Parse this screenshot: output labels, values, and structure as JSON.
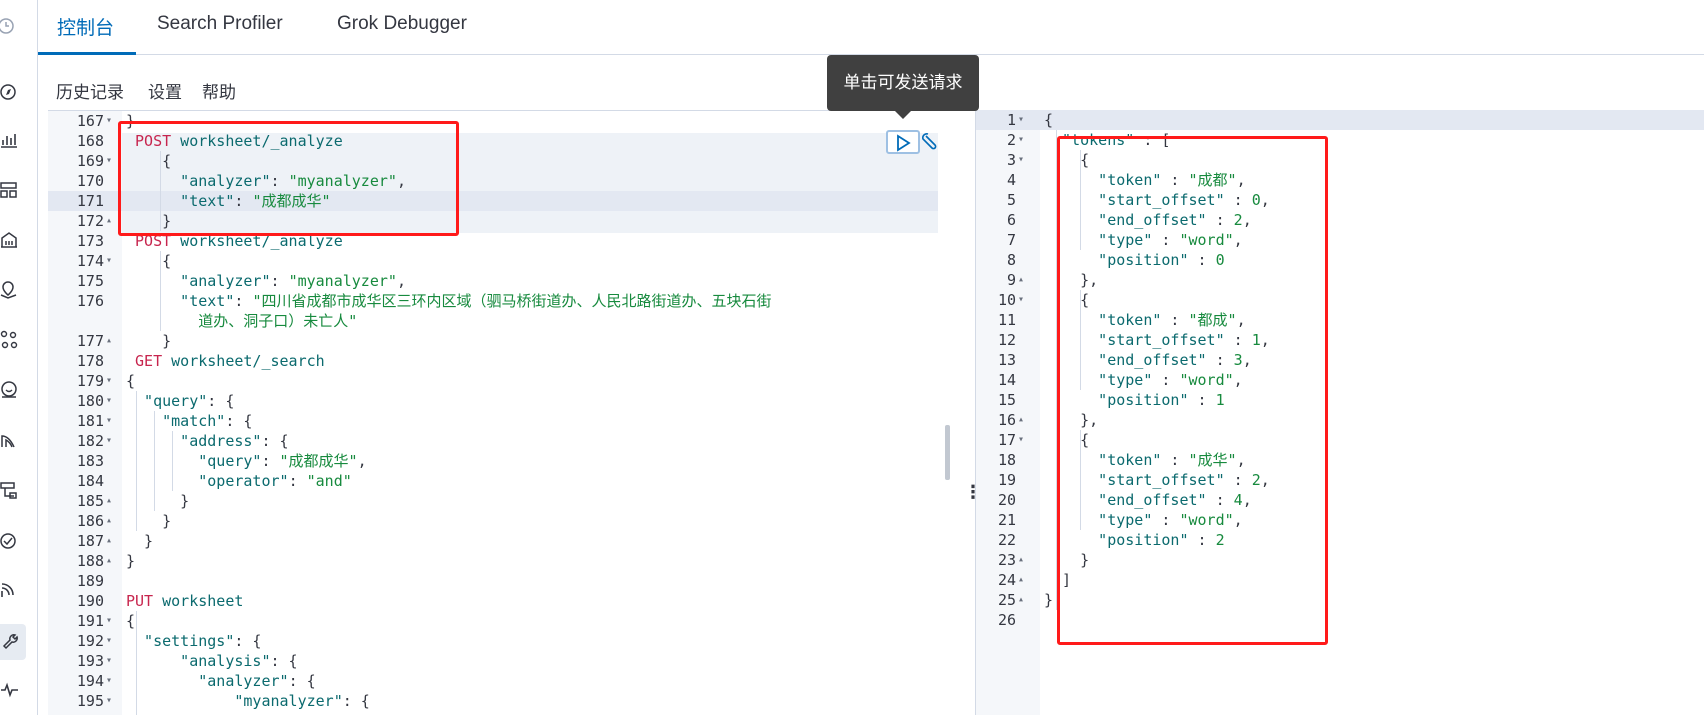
{
  "tabs": [
    {
      "label": "控制台",
      "active": true
    },
    {
      "label": "Search Profiler",
      "active": false
    },
    {
      "label": "Grok Debugger",
      "active": false
    }
  ],
  "subnav": {
    "history": "历史记录",
    "settings": "设置",
    "help": "帮助"
  },
  "tooltip": "单击可发送请求",
  "sidebar_icons": [
    "clock-icon",
    "compass-icon",
    "chart-icon",
    "dashboard-icon",
    "building-icon",
    "map-icon",
    "graph-icon",
    "face-icon",
    "apm-icon",
    "infra-icon",
    "uptime-icon",
    "signal-icon",
    "wrench-icon",
    "heartbeat-icon"
  ],
  "colors": {
    "accent": "#006bb8",
    "keyword": "#c7254e",
    "url": "#0b6a6e",
    "string": "#178a3e",
    "annotation": "#ff1a1a"
  },
  "request_lines": [
    {
      "n": "167",
      "fold": "▾",
      "segs": [
        {
          "t": "}",
          "c": "p"
        }
      ]
    },
    {
      "n": "168",
      "fold": "",
      "segs": [
        {
          "t": " POST",
          "c": "k"
        },
        {
          "t": " worksheet/_analyze",
          "c": "u"
        }
      ]
    },
    {
      "n": "169",
      "fold": "▾",
      "segs": [
        {
          "t": "    {",
          "c": "p"
        }
      ]
    },
    {
      "n": "170",
      "fold": "",
      "segs": [
        {
          "t": "      \"analyzer\"",
          "c": "u"
        },
        {
          "t": ": ",
          "c": "p"
        },
        {
          "t": "\"myanalyzer\"",
          "c": "s"
        },
        {
          "t": ",",
          "c": "p"
        }
      ]
    },
    {
      "n": "171",
      "fold": "",
      "segs": [
        {
          "t": "      \"text\"",
          "c": "u"
        },
        {
          "t": ": ",
          "c": "p"
        },
        {
          "t": "\"成都成华\"",
          "c": "s"
        }
      ]
    },
    {
      "n": "172",
      "fold": "▴",
      "segs": [
        {
          "t": "    }",
          "c": "p"
        }
      ]
    },
    {
      "n": "173",
      "fold": "",
      "segs": [
        {
          "t": " POST",
          "c": "k"
        },
        {
          "t": " worksheet/_analyze",
          "c": "u"
        }
      ]
    },
    {
      "n": "174",
      "fold": "▾",
      "segs": [
        {
          "t": "    {",
          "c": "p"
        }
      ]
    },
    {
      "n": "175",
      "fold": "",
      "segs": [
        {
          "t": "      \"analyzer\"",
          "c": "u"
        },
        {
          "t": ": ",
          "c": "p"
        },
        {
          "t": "\"myanalyzer\"",
          "c": "s"
        },
        {
          "t": ",",
          "c": "p"
        }
      ]
    },
    {
      "n": "176",
      "fold": "",
      "segs": [
        {
          "t": "      \"text\"",
          "c": "u"
        },
        {
          "t": ": ",
          "c": "p"
        },
        {
          "t": "\"四川省成都市成华区三环内区域（驷马桥街道办、人民北路街道办、五块石街",
          "c": "s"
        }
      ]
    },
    {
      "n": "",
      "fold": "",
      "segs": [
        {
          "t": "        道办、洞子口）未亡人\"",
          "c": "s"
        }
      ]
    },
    {
      "n": "177",
      "fold": "▴",
      "segs": [
        {
          "t": "    }",
          "c": "p"
        }
      ]
    },
    {
      "n": "178",
      "fold": "",
      "segs": [
        {
          "t": " GET",
          "c": "k"
        },
        {
          "t": " worksheet/_search",
          "c": "u"
        }
      ]
    },
    {
      "n": "179",
      "fold": "▾",
      "segs": [
        {
          "t": "{",
          "c": "p"
        }
      ]
    },
    {
      "n": "180",
      "fold": "▾",
      "segs": [
        {
          "t": "  \"query\"",
          "c": "u"
        },
        {
          "t": ": {",
          "c": "p"
        }
      ]
    },
    {
      "n": "181",
      "fold": "▾",
      "segs": [
        {
          "t": "    \"match\"",
          "c": "u"
        },
        {
          "t": ": {",
          "c": "p"
        }
      ]
    },
    {
      "n": "182",
      "fold": "▾",
      "segs": [
        {
          "t": "      \"address\"",
          "c": "u"
        },
        {
          "t": ": {",
          "c": "p"
        }
      ]
    },
    {
      "n": "183",
      "fold": "",
      "segs": [
        {
          "t": "        \"query\"",
          "c": "u"
        },
        {
          "t": ": ",
          "c": "p"
        },
        {
          "t": "\"成都成华\"",
          "c": "s"
        },
        {
          "t": ",",
          "c": "p"
        }
      ]
    },
    {
      "n": "184",
      "fold": "",
      "segs": [
        {
          "t": "        \"operator\"",
          "c": "u"
        },
        {
          "t": ": ",
          "c": "p"
        },
        {
          "t": "\"and\"",
          "c": "s"
        }
      ]
    },
    {
      "n": "185",
      "fold": "▴",
      "segs": [
        {
          "t": "      }",
          "c": "p"
        }
      ]
    },
    {
      "n": "186",
      "fold": "▴",
      "segs": [
        {
          "t": "    }",
          "c": "p"
        }
      ]
    },
    {
      "n": "187",
      "fold": "▴",
      "segs": [
        {
          "t": "  }",
          "c": "p"
        }
      ]
    },
    {
      "n": "188",
      "fold": "▴",
      "segs": [
        {
          "t": "}",
          "c": "p"
        }
      ]
    },
    {
      "n": "189",
      "fold": "",
      "segs": []
    },
    {
      "n": "190",
      "fold": "",
      "segs": [
        {
          "t": "PUT",
          "c": "k"
        },
        {
          "t": " worksheet",
          "c": "u"
        }
      ]
    },
    {
      "n": "191",
      "fold": "▾",
      "segs": [
        {
          "t": "{",
          "c": "p"
        }
      ]
    },
    {
      "n": "192",
      "fold": "▾",
      "segs": [
        {
          "t": "  \"settings\"",
          "c": "u"
        },
        {
          "t": ": {",
          "c": "p"
        }
      ]
    },
    {
      "n": "193",
      "fold": "▾",
      "segs": [
        {
          "t": "      \"analysis\"",
          "c": "u"
        },
        {
          "t": ": {",
          "c": "p"
        }
      ]
    },
    {
      "n": "194",
      "fold": "▾",
      "segs": [
        {
          "t": "        \"analyzer\"",
          "c": "u"
        },
        {
          "t": ": {",
          "c": "p"
        }
      ]
    },
    {
      "n": "195",
      "fold": "▾",
      "segs": [
        {
          "t": "            \"myanalyzer\"",
          "c": "u"
        },
        {
          "t": ": {",
          "c": "p"
        }
      ]
    }
  ],
  "response_lines": [
    {
      "n": "1",
      "fold": "▾",
      "segs": [
        {
          "t": "{",
          "c": "p"
        }
      ]
    },
    {
      "n": "2",
      "fold": "▾",
      "segs": [
        {
          "t": "  \"tokens\"",
          "c": "u"
        },
        {
          "t": " : [",
          "c": "p"
        }
      ]
    },
    {
      "n": "3",
      "fold": "▾",
      "segs": [
        {
          "t": "    {",
          "c": "p"
        }
      ]
    },
    {
      "n": "4",
      "fold": "",
      "segs": [
        {
          "t": "      \"token\"",
          "c": "u"
        },
        {
          "t": " : ",
          "c": "p"
        },
        {
          "t": "\"成都\"",
          "c": "s"
        },
        {
          "t": ",",
          "c": "p"
        }
      ]
    },
    {
      "n": "5",
      "fold": "",
      "segs": [
        {
          "t": "      \"start_offset\"",
          "c": "u"
        },
        {
          "t": " : ",
          "c": "p"
        },
        {
          "t": "0",
          "c": "s"
        },
        {
          "t": ",",
          "c": "p"
        }
      ]
    },
    {
      "n": "6",
      "fold": "",
      "segs": [
        {
          "t": "      \"end_offset\"",
          "c": "u"
        },
        {
          "t": " : ",
          "c": "p"
        },
        {
          "t": "2",
          "c": "s"
        },
        {
          "t": ",",
          "c": "p"
        }
      ]
    },
    {
      "n": "7",
      "fold": "",
      "segs": [
        {
          "t": "      \"type\"",
          "c": "u"
        },
        {
          "t": " : ",
          "c": "p"
        },
        {
          "t": "\"word\"",
          "c": "s"
        },
        {
          "t": ",",
          "c": "p"
        }
      ]
    },
    {
      "n": "8",
      "fold": "",
      "segs": [
        {
          "t": "      \"position\"",
          "c": "u"
        },
        {
          "t": " : ",
          "c": "p"
        },
        {
          "t": "0",
          "c": "s"
        }
      ]
    },
    {
      "n": "9",
      "fold": "▴",
      "segs": [
        {
          "t": "    },",
          "c": "p"
        }
      ]
    },
    {
      "n": "10",
      "fold": "▾",
      "segs": [
        {
          "t": "    {",
          "c": "p"
        }
      ]
    },
    {
      "n": "11",
      "fold": "",
      "segs": [
        {
          "t": "      \"token\"",
          "c": "u"
        },
        {
          "t": " : ",
          "c": "p"
        },
        {
          "t": "\"都成\"",
          "c": "s"
        },
        {
          "t": ",",
          "c": "p"
        }
      ]
    },
    {
      "n": "12",
      "fold": "",
      "segs": [
        {
          "t": "      \"start_offset\"",
          "c": "u"
        },
        {
          "t": " : ",
          "c": "p"
        },
        {
          "t": "1",
          "c": "s"
        },
        {
          "t": ",",
          "c": "p"
        }
      ]
    },
    {
      "n": "13",
      "fold": "",
      "segs": [
        {
          "t": "      \"end_offset\"",
          "c": "u"
        },
        {
          "t": " : ",
          "c": "p"
        },
        {
          "t": "3",
          "c": "s"
        },
        {
          "t": ",",
          "c": "p"
        }
      ]
    },
    {
      "n": "14",
      "fold": "",
      "segs": [
        {
          "t": "      \"type\"",
          "c": "u"
        },
        {
          "t": " : ",
          "c": "p"
        },
        {
          "t": "\"word\"",
          "c": "s"
        },
        {
          "t": ",",
          "c": "p"
        }
      ]
    },
    {
      "n": "15",
      "fold": "",
      "segs": [
        {
          "t": "      \"position\"",
          "c": "u"
        },
        {
          "t": " : ",
          "c": "p"
        },
        {
          "t": "1",
          "c": "s"
        }
      ]
    },
    {
      "n": "16",
      "fold": "▴",
      "segs": [
        {
          "t": "    },",
          "c": "p"
        }
      ]
    },
    {
      "n": "17",
      "fold": "▾",
      "segs": [
        {
          "t": "    {",
          "c": "p"
        }
      ]
    },
    {
      "n": "18",
      "fold": "",
      "segs": [
        {
          "t": "      \"token\"",
          "c": "u"
        },
        {
          "t": " : ",
          "c": "p"
        },
        {
          "t": "\"成华\"",
          "c": "s"
        },
        {
          "t": ",",
          "c": "p"
        }
      ]
    },
    {
      "n": "19",
      "fold": "",
      "segs": [
        {
          "t": "      \"start_offset\"",
          "c": "u"
        },
        {
          "t": " : ",
          "c": "p"
        },
        {
          "t": "2",
          "c": "s"
        },
        {
          "t": ",",
          "c": "p"
        }
      ]
    },
    {
      "n": "20",
      "fold": "",
      "segs": [
        {
          "t": "      \"end_offset\"",
          "c": "u"
        },
        {
          "t": " : ",
          "c": "p"
        },
        {
          "t": "4",
          "c": "s"
        },
        {
          "t": ",",
          "c": "p"
        }
      ]
    },
    {
      "n": "21",
      "fold": "",
      "segs": [
        {
          "t": "      \"type\"",
          "c": "u"
        },
        {
          "t": " : ",
          "c": "p"
        },
        {
          "t": "\"word\"",
          "c": "s"
        },
        {
          "t": ",",
          "c": "p"
        }
      ]
    },
    {
      "n": "22",
      "fold": "",
      "segs": [
        {
          "t": "      \"position\"",
          "c": "u"
        },
        {
          "t": " : ",
          "c": "p"
        },
        {
          "t": "2",
          "c": "s"
        }
      ]
    },
    {
      "n": "23",
      "fold": "▴",
      "segs": [
        {
          "t": "    }",
          "c": "p"
        }
      ]
    },
    {
      "n": "24",
      "fold": "▴",
      "segs": [
        {
          "t": "  ]",
          "c": "p"
        }
      ]
    },
    {
      "n": "25",
      "fold": "▴",
      "segs": [
        {
          "t": "}",
          "c": "p"
        }
      ]
    },
    {
      "n": "26",
      "fold": "",
      "segs": []
    }
  ]
}
